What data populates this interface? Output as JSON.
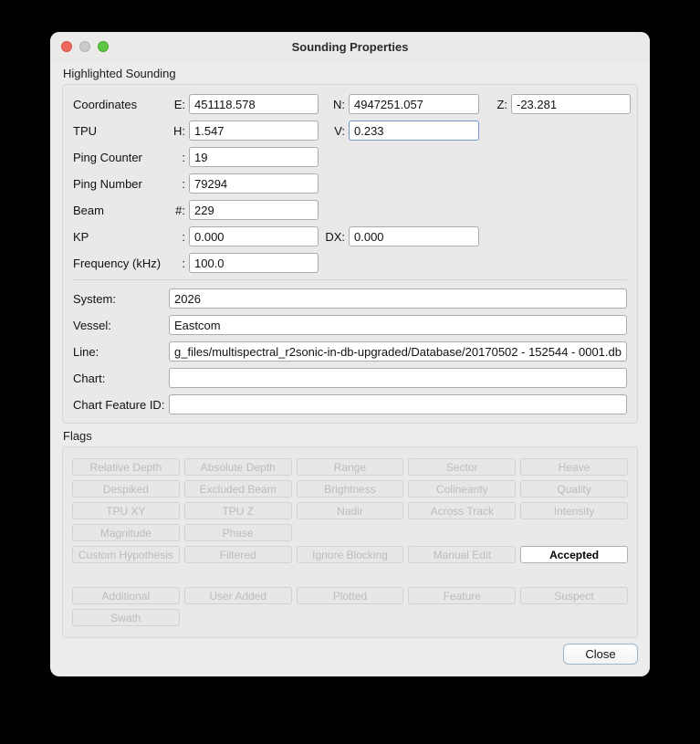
{
  "window": {
    "title": "Sounding Properties"
  },
  "titlebar_buttons": {
    "close": "close",
    "minimize": "minimize",
    "zoom": "zoom"
  },
  "highlighted": {
    "group_label": "Highlighted Sounding",
    "coordinates": {
      "label": "Coordinates",
      "e_prefix": "E:",
      "e": "451118.578",
      "n_prefix": "N:",
      "n": "4947251.057",
      "z_prefix": "Z:",
      "z": "-23.281"
    },
    "tpu": {
      "label": "TPU",
      "h_prefix": "H:",
      "h": "1.547",
      "v_prefix": "V:",
      "v": "0.233"
    },
    "ping_counter": {
      "label": "Ping Counter",
      "prefix": ":",
      "value": "19"
    },
    "ping_number": {
      "label": "Ping Number",
      "prefix": ":",
      "value": "79294"
    },
    "beam": {
      "label": "Beam",
      "prefix": "#:",
      "value": "229"
    },
    "kp": {
      "label": "KP",
      "prefix": ":",
      "value": "0.000",
      "dx_prefix": "DX:",
      "dx": "0.000"
    },
    "frequency": {
      "label": "Frequency (kHz)",
      "prefix": ":",
      "value": "100.0"
    },
    "system": {
      "label": "System:",
      "value": "2026"
    },
    "vessel": {
      "label": "Vessel:",
      "value": "Eastcom"
    },
    "line": {
      "label": "Line:",
      "value": "g_files/multispectral_r2sonic-in-db-upgraded/Database/20170502 - 152544 - 0001.db"
    },
    "chart": {
      "label": "Chart:",
      "value": ""
    },
    "chart_feature_id": {
      "label": "Chart Feature ID:",
      "value": ""
    }
  },
  "flags": {
    "group_label": "Flags",
    "active_flag": "Accepted",
    "buttons": [
      "Relative Depth",
      "Absolute Depth",
      "Range",
      "Sector",
      "Heave",
      "Despiked",
      "Excluded Beam",
      "Brightness",
      "Colinearity",
      "Quality",
      "TPU XY",
      "TPU Z",
      "Nadir",
      "Across Track",
      "Intensity",
      "Magnitude",
      "Phase",
      "Custom Hypothesis",
      "Filtered",
      "Ignore Blocking",
      "Manual Edit",
      "Accepted",
      "Additional",
      "User Added",
      "Plotted",
      "Feature",
      "Suspect",
      "Swath"
    ]
  },
  "footer": {
    "close_label": "Close"
  }
}
